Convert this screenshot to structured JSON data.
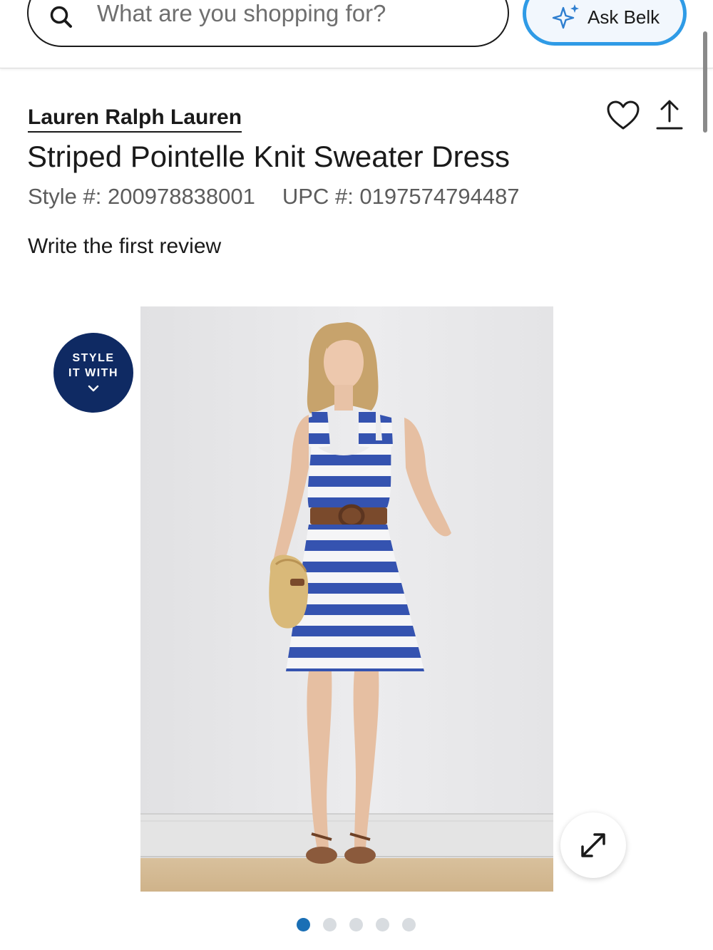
{
  "header": {
    "search_placeholder": "What are you shopping for?",
    "ask_label": "Ask Belk",
    "icons": {
      "search": "search-icon",
      "ask": "sparkle-icon"
    }
  },
  "product": {
    "brand": "Lauren Ralph Lauren",
    "title": "Striped Pointelle Knit Sweater Dress",
    "style_number": "Style #: 200978838001",
    "upc_number": "UPC #: 0197574794487",
    "review_link": "Write the first review",
    "icons": {
      "wishlist": "heart-icon",
      "share": "share-icon",
      "expand": "expand-icon"
    }
  },
  "style_badge": {
    "line1": "STYLE",
    "line2": "IT WITH",
    "icon": "chevron-down-icon"
  },
  "gallery": {
    "image_alt": "Model wearing blue and white striped sleeveless knit dress with brown belt, holding straw bag",
    "dots": [
      {
        "active": true
      },
      {
        "active": false
      },
      {
        "active": false
      },
      {
        "active": false
      },
      {
        "active": false
      }
    ]
  },
  "colors": {
    "accent_blue": "#2f9be6",
    "badge_navy": "#0f2a63",
    "dot_active": "#1a6fb5",
    "stripe_blue": "#3553b0"
  }
}
